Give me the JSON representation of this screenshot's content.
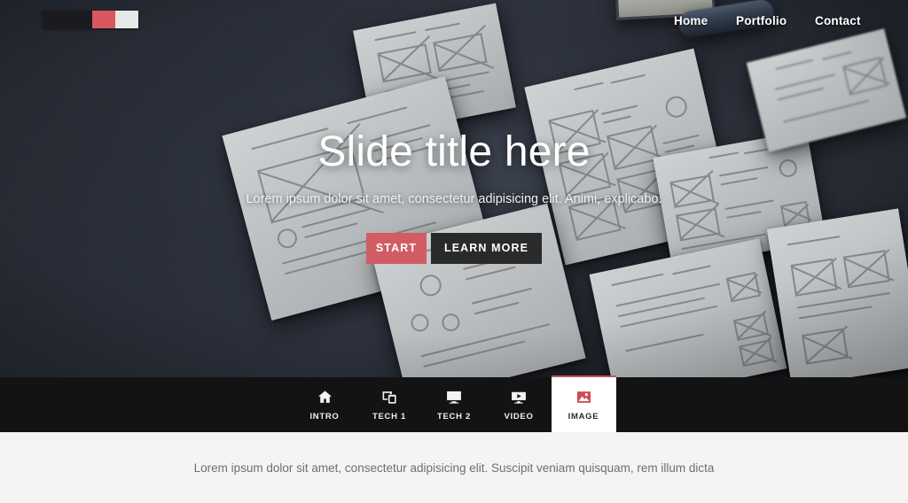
{
  "header": {
    "logo_name": "three-block-logo",
    "logo_colors": {
      "block1": "#1b1b1f",
      "block2": "#d9575f",
      "block3": "#e8e8e8"
    },
    "nav": [
      {
        "label": "Home",
        "name": "nav-link-home"
      },
      {
        "label": "Portfolio",
        "name": "nav-link-portfolio"
      },
      {
        "label": "Contact",
        "name": "nav-link-contact"
      }
    ]
  },
  "hero": {
    "title": "Slide title here",
    "subtitle": "Lorem ipsum dolor sit amet, consectetur adipisicing elit. Animi, explicabo.",
    "primary_button": "START",
    "secondary_button": "LEARN MORE",
    "primary_color": "#d15c63",
    "secondary_color": "#2a2a2a",
    "background": "photo of hand-drawn wireframe sketches on paper over a dark desk"
  },
  "tabs": {
    "active_index": 4,
    "items": [
      {
        "label": "INTRO",
        "icon": "home-icon"
      },
      {
        "label": "TECH 1",
        "icon": "devices-icon"
      },
      {
        "label": "TECH 2",
        "icon": "monitor-icon"
      },
      {
        "label": "VIDEO",
        "icon": "video-player-icon"
      },
      {
        "label": "IMAGE",
        "icon": "image-icon"
      }
    ],
    "active_bg": "#ffffff",
    "active_accent": "#c9535b",
    "bar_bg": "#131313"
  },
  "lower": {
    "text": "Lorem ipsum dolor sit amet, consectetur adipisicing elit. Suscipit veniam quisquam, rem illum dicta",
    "bg": "#f4f4f4"
  }
}
